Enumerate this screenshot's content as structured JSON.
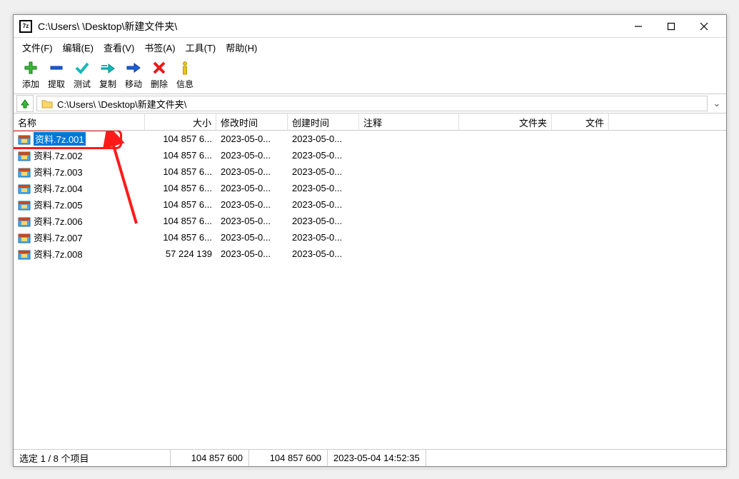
{
  "window": {
    "title": "C:\\Users\\        \\Desktop\\新建文件夹\\"
  },
  "menu": {
    "file": "文件(F)",
    "edit": "编辑(E)",
    "view": "查看(V)",
    "bookmarks": "书签(A)",
    "tools": "工具(T)",
    "help": "帮助(H)"
  },
  "toolbar": {
    "add": "添加",
    "extract": "提取",
    "test": "测试",
    "copy": "复制",
    "move": "移动",
    "delete": "删除",
    "info": "信息"
  },
  "path": {
    "value": "C:\\Users\\          \\Desktop\\新建文件夹\\"
  },
  "columns": {
    "name": "名称",
    "size": "大小",
    "modified": "修改时间",
    "created": "创建时间",
    "comment": "注释",
    "folders": "文件夹",
    "files": "文件"
  },
  "files": [
    {
      "name": "资料.7z.001",
      "size": "104 857 6...",
      "modified": "2023-05-0...",
      "created": "2023-05-0...",
      "selected": true
    },
    {
      "name": "资料.7z.002",
      "size": "104 857 6...",
      "modified": "2023-05-0...",
      "created": "2023-05-0...",
      "selected": false
    },
    {
      "name": "资料.7z.003",
      "size": "104 857 6...",
      "modified": "2023-05-0...",
      "created": "2023-05-0...",
      "selected": false
    },
    {
      "name": "资料.7z.004",
      "size": "104 857 6...",
      "modified": "2023-05-0...",
      "created": "2023-05-0...",
      "selected": false
    },
    {
      "name": "资料.7z.005",
      "size": "104 857 6...",
      "modified": "2023-05-0...",
      "created": "2023-05-0...",
      "selected": false
    },
    {
      "name": "资料.7z.006",
      "size": "104 857 6...",
      "modified": "2023-05-0...",
      "created": "2023-05-0...",
      "selected": false
    },
    {
      "name": "资料.7z.007",
      "size": "104 857 6...",
      "modified": "2023-05-0...",
      "created": "2023-05-0...",
      "selected": false
    },
    {
      "name": "资料.7z.008",
      "size": "57 224 139",
      "modified": "2023-05-0...",
      "created": "2023-05-0...",
      "selected": false
    }
  ],
  "status": {
    "selection": "选定 1 / 8 个项目",
    "size1": "104 857 600",
    "size2": "104 857 600",
    "datetime": "2023-05-04 14:52:35"
  }
}
